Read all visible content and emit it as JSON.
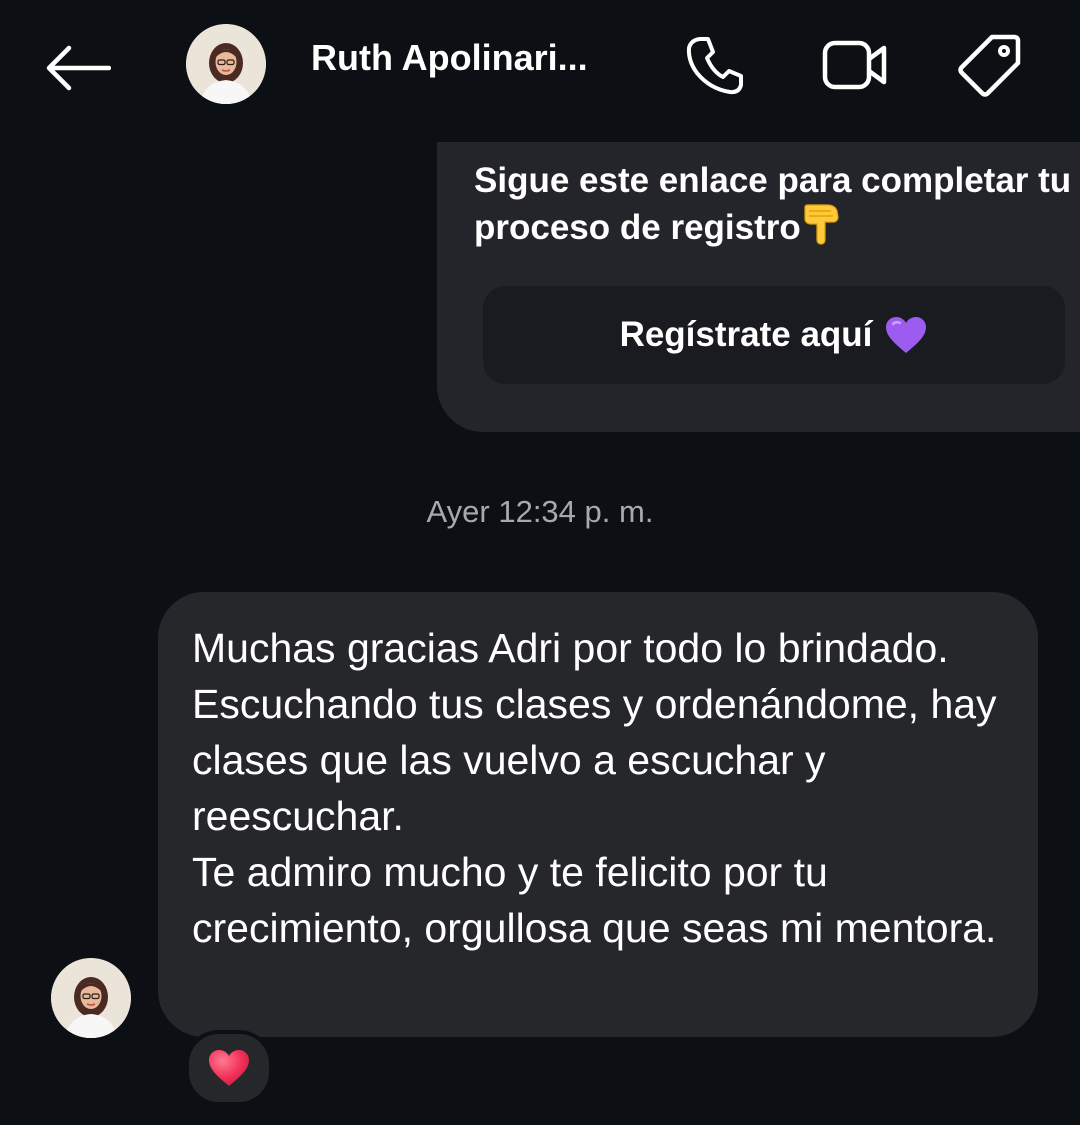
{
  "header": {
    "contact_name": "Ruth Apolinari...",
    "back_icon": "arrow-left-icon",
    "call_icon": "phone-icon",
    "video_icon": "video-camera-icon",
    "tag_icon": "tag-icon"
  },
  "outgoing": {
    "text": "Sigue este enlace para completar tu proceso de registro",
    "pointing_emoji": "backhand-index-pointing-down-icon",
    "button_label": "Regístrate aquí",
    "button_emoji": "purple-heart-icon"
  },
  "timestamp": "Ayer 12:34 p. m.",
  "incoming": {
    "text": "Muchas gracias Adri por todo lo brindado. Escuchando tus clases y ordenándome, hay clases que las vuelvo a escuchar y reescuchar.\nTe admiro mucho y te felicito por tu crecimiento, orgullosa que seas mi mentora.",
    "reaction": "red-heart-icon"
  },
  "colors": {
    "background": "#0c0f14",
    "bubble": "#26272b",
    "outgoing_card": "#24252a",
    "button": "#1a1b21",
    "timestamp": "#a8a9ad"
  }
}
